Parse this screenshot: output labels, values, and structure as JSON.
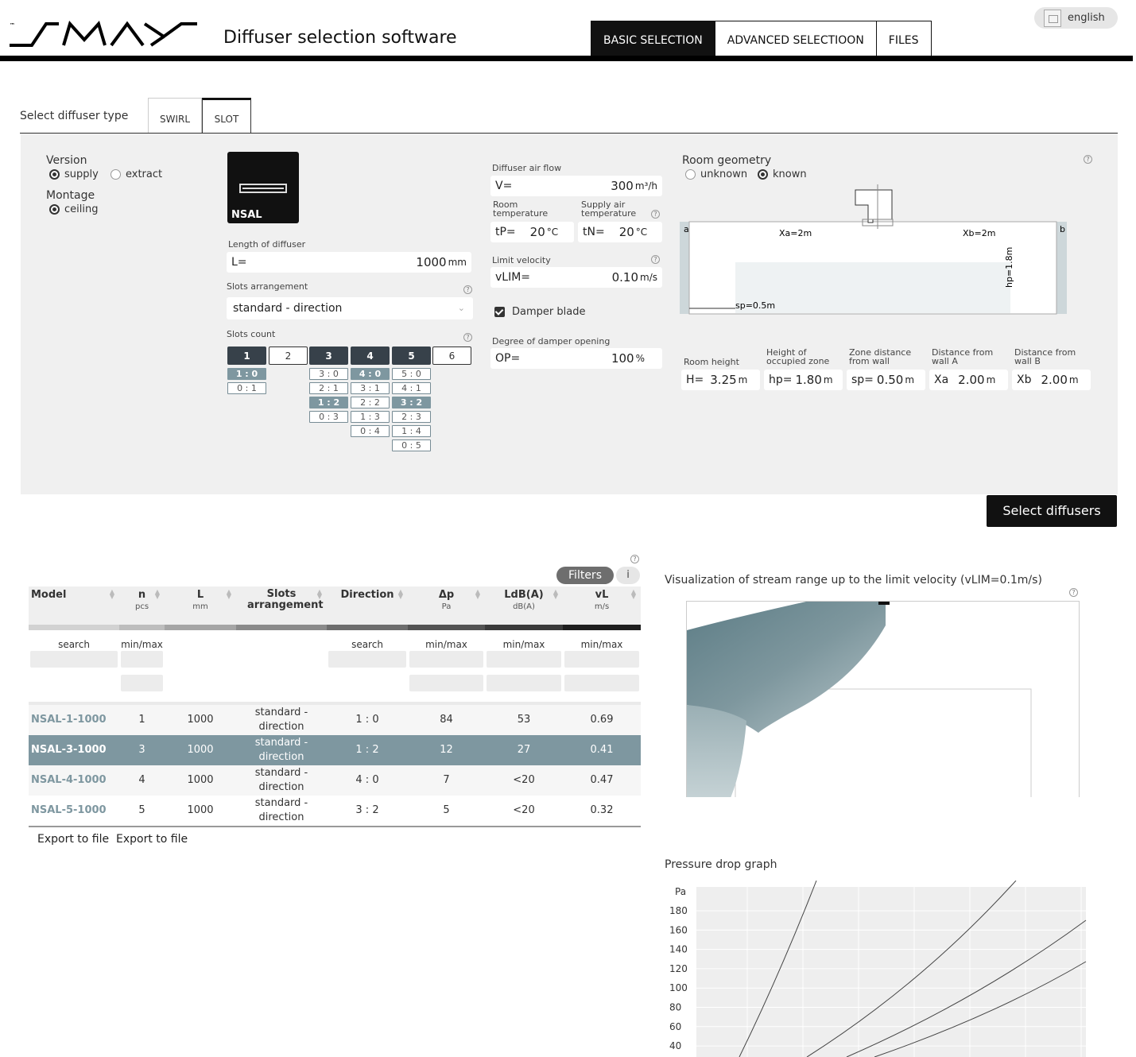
{
  "header": {
    "brand": "SMAY",
    "tm": "™",
    "title": "Diffuser selection software",
    "nav": [
      "BASIC SELECTION",
      "ADVANCED SELECTIOON",
      "FILES"
    ],
    "language": "english"
  },
  "diffuser_type": {
    "label": "Select diffuser type",
    "tabs": [
      "SWIRL",
      "SLOT"
    ],
    "active": "SLOT"
  },
  "version": {
    "label": "Version",
    "options": [
      "supply",
      "extract"
    ],
    "selected": "supply"
  },
  "montage": {
    "label": "Montage",
    "options": [
      "ceiling"
    ],
    "selected": "ceiling"
  },
  "product": {
    "name": "NSAL"
  },
  "length": {
    "label": "Length of diffuser",
    "prefix": "L=",
    "value": "1000",
    "unit": "mm"
  },
  "slots_arrangement": {
    "label": "Slots arrangement",
    "value": "standard - direction"
  },
  "slots_count": {
    "label": "Slots count",
    "buttons": [
      "1",
      "2",
      "3",
      "4",
      "5",
      "6"
    ],
    "options": {
      "1": [
        "1 : 0",
        "0 : 1"
      ],
      "3": [
        "3 : 0",
        "2 : 1",
        "1 : 2",
        "0 : 3"
      ],
      "4": [
        "4 : 0",
        "3 : 1",
        "2 : 2",
        "1 : 3",
        "0 : 4"
      ],
      "5": [
        "5 : 0",
        "4 : 1",
        "3 : 2",
        "2 : 3",
        "1 : 4",
        "0 : 5"
      ]
    }
  },
  "air_flow": {
    "label": "Diffuser air flow",
    "prefix": "V=",
    "value": "300",
    "unit": "m³/h"
  },
  "room_temp": {
    "label": "Room temperature",
    "prefix": "tP=",
    "value": "20",
    "unit": "°C"
  },
  "supply_temp": {
    "label": "Supply air temperature",
    "prefix": "tN=",
    "value": "20",
    "unit": "°C"
  },
  "limit_velocity": {
    "label": "Limit velocity",
    "prefix": "vLIM=",
    "value": "0.10",
    "unit": "m/s"
  },
  "damper_blade": {
    "label": "Damper blade",
    "checked": true
  },
  "damper_opening": {
    "label": "Degree of damper opening",
    "prefix": "OP=",
    "value": "100",
    "unit": "%"
  },
  "room_geometry": {
    "label": "Room geometry",
    "options": [
      "unknown",
      "known"
    ],
    "selected": "known",
    "diagram": {
      "a": "a",
      "b": "b",
      "xa": "Xa=2m",
      "xb": "Xb=2m",
      "hp": "hp=1.8m",
      "sp": "sp=0.5m"
    },
    "fields": [
      {
        "label": "Room height",
        "prefix": "H=",
        "value": "3.25",
        "unit": "m"
      },
      {
        "label": "Height of occupied zone",
        "prefix": "hp=",
        "value": "1.80",
        "unit": "m"
      },
      {
        "label": "Zone distance from wall",
        "prefix": "sp=",
        "value": "0.50",
        "unit": "m"
      },
      {
        "label": "Distance from wall A",
        "prefix": "Xa",
        "value": "2.00",
        "unit": "m"
      },
      {
        "label": "Distance from wall B",
        "prefix": "Xb",
        "value": "2.00",
        "unit": "m"
      }
    ]
  },
  "select_button": "Select diffusers",
  "table": {
    "filters_label": "Filters",
    "info_label": "i",
    "columns": [
      {
        "name": "Model",
        "sub": ""
      },
      {
        "name": "n",
        "sub": "pcs"
      },
      {
        "name": "L",
        "sub": "mm"
      },
      {
        "name": "Slots arrangement",
        "sub": ""
      },
      {
        "name": "Direction",
        "sub": ""
      },
      {
        "name": "Δp",
        "sub": "Pa"
      },
      {
        "name": "LdB(A)",
        "sub": "dB(A)"
      },
      {
        "name": "vL",
        "sub": "m/s"
      }
    ],
    "filter_labels": [
      "search",
      "min/max",
      "search",
      "min/max",
      "min/max",
      "min/max"
    ],
    "rows": [
      {
        "model": "NSAL-1-1000",
        "n": "1",
        "L": "1000",
        "arr": "standard - direction",
        "dir": "1 : 0",
        "dp": "84",
        "ldb": "53",
        "vl": "0.69",
        "selected": false
      },
      {
        "model": "NSAL-3-1000",
        "n": "3",
        "L": "1000",
        "arr": "standard - direction",
        "dir": "1 : 2",
        "dp": "12",
        "ldb": "27",
        "vl": "0.41",
        "selected": true
      },
      {
        "model": "NSAL-4-1000",
        "n": "4",
        "L": "1000",
        "arr": "standard - direction",
        "dir": "4 : 0",
        "dp": "7",
        "ldb": "<20",
        "vl": "0.47",
        "selected": false
      },
      {
        "model": "NSAL-5-1000",
        "n": "5",
        "L": "1000",
        "arr": "standard - direction",
        "dir": "3 : 2",
        "dp": "5",
        "ldb": "<20",
        "vl": "0.32",
        "selected": false
      }
    ],
    "export": [
      "Export to file",
      "Export to file"
    ]
  },
  "visualization": {
    "title": "Visualization of stream range up to the limit velocity (vLIM=0.1m/s)"
  },
  "pressure_graph": {
    "title": "Pressure drop graph",
    "unit": "Pa",
    "ticks": [
      "180",
      "160",
      "140",
      "120",
      "100",
      "80",
      "60",
      "40"
    ]
  },
  "colors": {
    "accent": "#7e97a0",
    "dark": "#37414a",
    "panel": "#f0f0f0"
  }
}
